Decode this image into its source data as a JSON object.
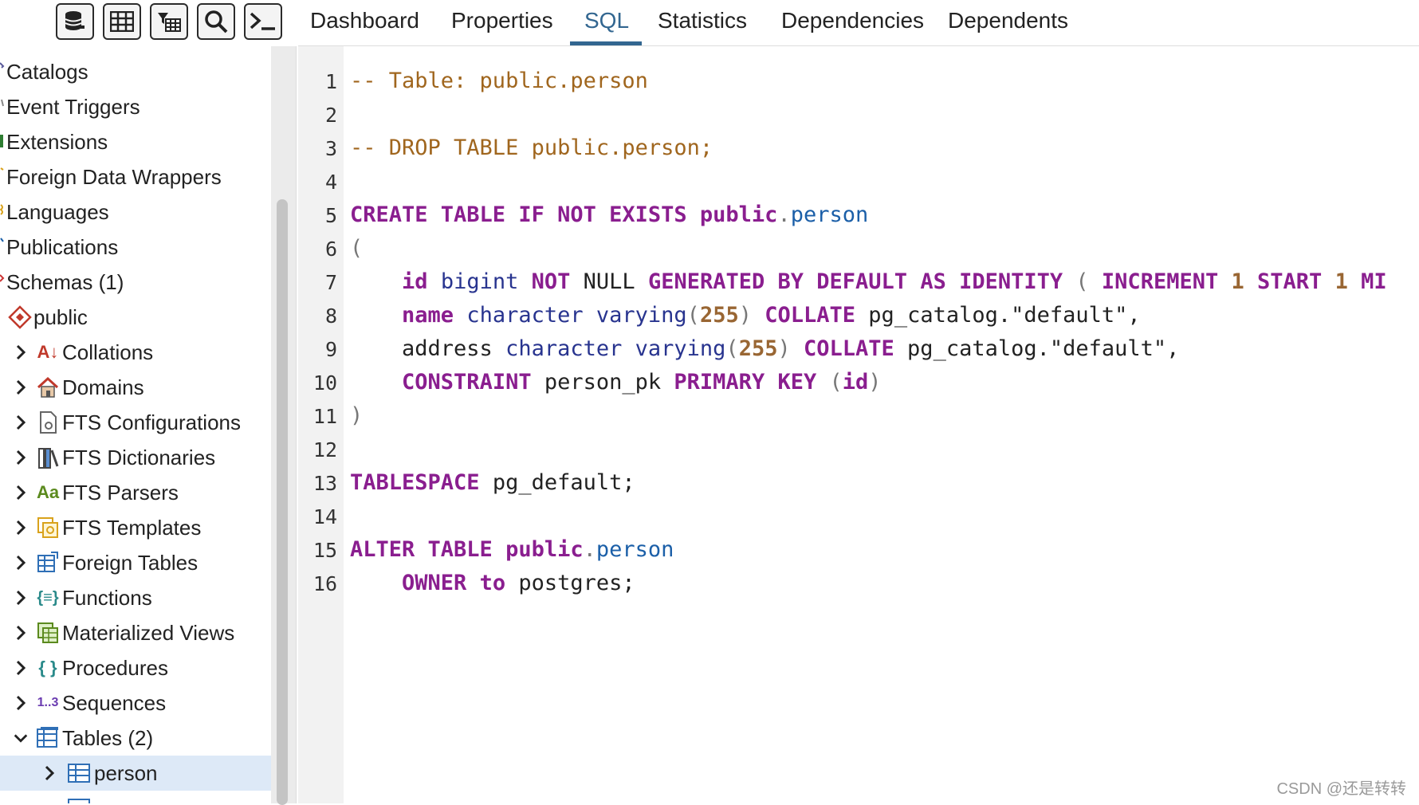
{
  "toolbar": {
    "buttons": [
      {
        "icon": "database-icon"
      },
      {
        "icon": "table-view-icon"
      },
      {
        "icon": "filtered-rows-icon"
      },
      {
        "icon": "search-icon"
      },
      {
        "icon": "terminal-icon"
      }
    ]
  },
  "tabs": [
    {
      "label": "Dashboard",
      "active": false
    },
    {
      "label": "Properties",
      "active": false
    },
    {
      "label": "SQL",
      "active": true
    },
    {
      "label": "Statistics",
      "active": false
    },
    {
      "label": "Dependencies",
      "active": false
    },
    {
      "label": "Dependents",
      "active": false
    }
  ],
  "tree": [
    {
      "label": "Catalogs",
      "icon": "catalogs-icon",
      "expand": "none",
      "depth": 0
    },
    {
      "label": "Event Triggers",
      "icon": "event-triggers-icon",
      "expand": "none",
      "depth": 0
    },
    {
      "label": "Extensions",
      "icon": "extensions-icon",
      "expand": "none",
      "depth": 0
    },
    {
      "label": "Foreign Data Wrappers",
      "icon": "foreign-data-wrappers-icon",
      "expand": "none",
      "depth": 0
    },
    {
      "label": "Languages",
      "icon": "languages-icon",
      "expand": "none",
      "depth": 0
    },
    {
      "label": "Publications",
      "icon": "publications-icon",
      "expand": "none",
      "depth": 0
    },
    {
      "label": "Schemas (1)",
      "icon": "schemas-icon",
      "expand": "none",
      "depth": 0
    },
    {
      "label": "public",
      "icon": "schema-public-icon",
      "expand": "none",
      "depth": 1
    },
    {
      "label": "Collations",
      "icon": "collations-icon",
      "expand": "collapsed",
      "depth": 2
    },
    {
      "label": "Domains",
      "icon": "domains-icon",
      "expand": "collapsed",
      "depth": 2
    },
    {
      "label": "FTS Configurations",
      "icon": "fts-configurations-icon",
      "expand": "collapsed",
      "depth": 2
    },
    {
      "label": "FTS Dictionaries",
      "icon": "fts-dictionaries-icon",
      "expand": "collapsed",
      "depth": 2
    },
    {
      "label": "FTS Parsers",
      "icon": "fts-parsers-icon",
      "expand": "collapsed",
      "depth": 2
    },
    {
      "label": "FTS Templates",
      "icon": "fts-templates-icon",
      "expand": "collapsed",
      "depth": 2
    },
    {
      "label": "Foreign Tables",
      "icon": "foreign-tables-icon",
      "expand": "collapsed",
      "depth": 2
    },
    {
      "label": "Functions",
      "icon": "functions-icon",
      "expand": "collapsed",
      "depth": 2
    },
    {
      "label": "Materialized Views",
      "icon": "materialized-views-icon",
      "expand": "collapsed",
      "depth": 2
    },
    {
      "label": "Procedures",
      "icon": "procedures-icon",
      "expand": "collapsed",
      "depth": 2
    },
    {
      "label": "Sequences",
      "icon": "sequences-icon",
      "expand": "collapsed",
      "depth": 2
    },
    {
      "label": "Tables (2)",
      "icon": "tables-icon",
      "expand": "expanded",
      "depth": 2
    },
    {
      "label": "person",
      "icon": "table-icon",
      "expand": "collapsed",
      "depth": 3,
      "selected": true
    }
  ],
  "icon_glyphs": {
    "collations": "A↓",
    "fts_parsers": "Aa",
    "sequences": "1..3",
    "functions": "{≡}",
    "procedures": "{ }"
  },
  "colors": {
    "accent": "#326690",
    "keyword": "#8a1e8f",
    "comment": "#a0661e",
    "type": "#28348f",
    "number": "#996633",
    "selected_row": "#dde9f7"
  },
  "code_lines": [
    [
      [
        "cm",
        "-- Table: public.person"
      ]
    ],
    [],
    [
      [
        "cm",
        "-- DROP TABLE public.person;"
      ]
    ],
    [],
    [
      [
        "kw",
        "CREATE TABLE IF NOT EXISTS public"
      ],
      [
        "br",
        "."
      ],
      [
        "ob",
        "person"
      ]
    ],
    [
      [
        "br",
        "("
      ]
    ],
    [
      [
        "tx",
        "    "
      ],
      [
        "kw",
        "id"
      ],
      [
        "tx",
        " "
      ],
      [
        "ty",
        "bigint"
      ],
      [
        "tx",
        " "
      ],
      [
        "kw",
        "NOT"
      ],
      [
        "tx",
        " NULL "
      ],
      [
        "kw",
        "GENERATED BY DEFAULT AS IDENTITY"
      ],
      [
        "tx",
        " "
      ],
      [
        "br",
        "("
      ],
      [
        "tx",
        " "
      ],
      [
        "kw",
        "INCREMENT"
      ],
      [
        "tx",
        " "
      ],
      [
        "nm",
        "1"
      ],
      [
        "tx",
        " "
      ],
      [
        "kw",
        "START"
      ],
      [
        "tx",
        " "
      ],
      [
        "nm",
        "1"
      ],
      [
        "tx",
        " "
      ],
      [
        "kw",
        "MI"
      ]
    ],
    [
      [
        "tx",
        "    "
      ],
      [
        "kw",
        "name"
      ],
      [
        "tx",
        " "
      ],
      [
        "ty",
        "character varying"
      ],
      [
        "br",
        "("
      ],
      [
        "nm",
        "255"
      ],
      [
        "br",
        ")"
      ],
      [
        "tx",
        " "
      ],
      [
        "kw",
        "COLLATE"
      ],
      [
        "tx",
        " pg_catalog.\"default\","
      ]
    ],
    [
      [
        "tx",
        "    address "
      ],
      [
        "ty",
        "character varying"
      ],
      [
        "br",
        "("
      ],
      [
        "nm",
        "255"
      ],
      [
        "br",
        ")"
      ],
      [
        "tx",
        " "
      ],
      [
        "kw",
        "COLLATE"
      ],
      [
        "tx",
        " pg_catalog.\"default\","
      ]
    ],
    [
      [
        "tx",
        "    "
      ],
      [
        "kw",
        "CONSTRAINT"
      ],
      [
        "tx",
        " person_pk "
      ],
      [
        "kw",
        "PRIMARY KEY"
      ],
      [
        "tx",
        " "
      ],
      [
        "br",
        "("
      ],
      [
        "kw",
        "id"
      ],
      [
        "br",
        ")"
      ]
    ],
    [
      [
        "br",
        ")"
      ]
    ],
    [],
    [
      [
        "kw",
        "TABLESPACE"
      ],
      [
        "tx",
        " pg_default;"
      ]
    ],
    [],
    [
      [
        "kw",
        "ALTER TABLE public"
      ],
      [
        "br",
        "."
      ],
      [
        "ob",
        "person"
      ]
    ],
    [
      [
        "tx",
        "    "
      ],
      [
        "kw",
        "OWNER"
      ],
      [
        "tx",
        " "
      ],
      [
        "kw",
        "to"
      ],
      [
        "tx",
        " postgres;"
      ]
    ]
  ],
  "watermark": "CSDN @还是转转"
}
